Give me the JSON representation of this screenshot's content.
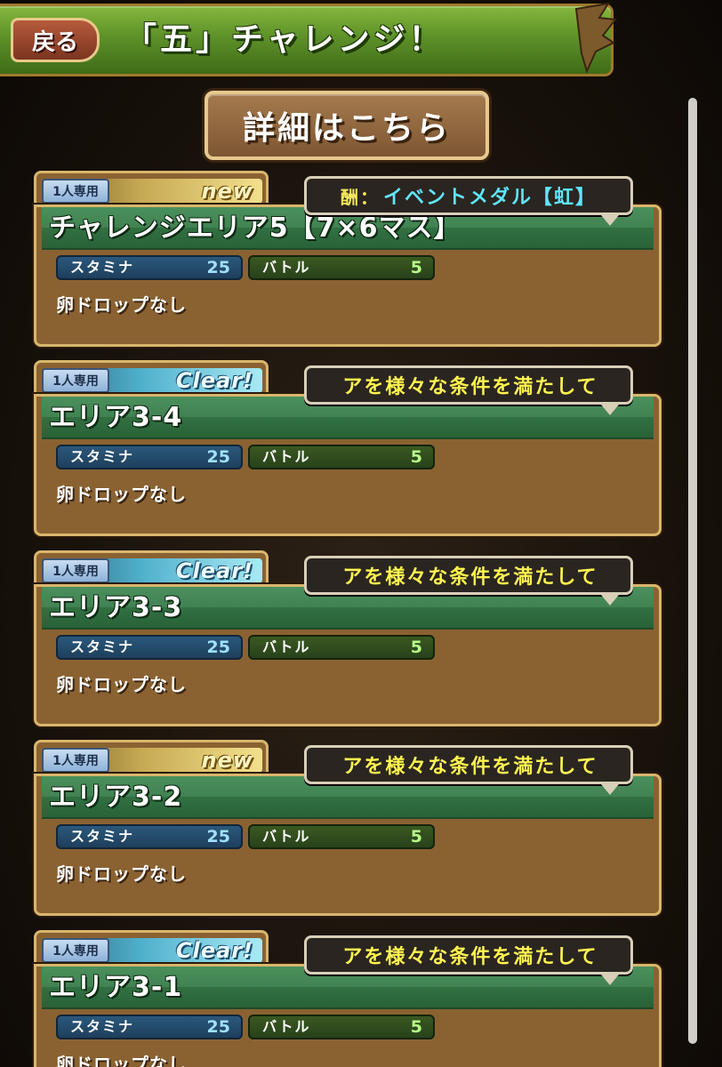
{
  "header": {
    "back_label": "戻る",
    "title": "「五」チャレンジ！"
  },
  "details_button_label": "詳細はこちら",
  "quests": [
    {
      "solo_label": "1人専用",
      "status": "new",
      "name": "チャレンジエリア5【7×6マス】",
      "bubble_prefix": "酬：",
      "bubble_text": "イベントメダル【虹】",
      "stamina_label": "スタミナ",
      "stamina_value": "25",
      "battle_label": "バトル",
      "battle_value": "5",
      "drop_text": "卵ドロップなし"
    },
    {
      "solo_label": "1人専用",
      "status": "Clear!",
      "name": "エリア3-4",
      "bubble_prefix": "",
      "bubble_text": "アを様々な条件を満たして",
      "stamina_label": "スタミナ",
      "stamina_value": "25",
      "battle_label": "バトル",
      "battle_value": "5",
      "drop_text": "卵ドロップなし"
    },
    {
      "solo_label": "1人専用",
      "status": "Clear!",
      "name": "エリア3-3",
      "bubble_prefix": "",
      "bubble_text": "アを様々な条件を満たして",
      "stamina_label": "スタミナ",
      "stamina_value": "25",
      "battle_label": "バトル",
      "battle_value": "5",
      "drop_text": "卵ドロップなし"
    },
    {
      "solo_label": "1人専用",
      "status": "new",
      "name": "エリア3-2",
      "bubble_prefix": "",
      "bubble_text": "アを様々な条件を満たして",
      "stamina_label": "スタミナ",
      "stamina_value": "25",
      "battle_label": "バトル",
      "battle_value": "5",
      "drop_text": "卵ドロップなし"
    },
    {
      "solo_label": "1人専用",
      "status": "Clear!",
      "name": "エリア3-1",
      "bubble_prefix": "",
      "bubble_text": "アを様々な条件を満たして",
      "stamina_label": "スタミナ",
      "stamina_value": "25",
      "battle_label": "バトル",
      "battle_value": "5",
      "drop_text": "卵ドロップなし"
    }
  ]
}
